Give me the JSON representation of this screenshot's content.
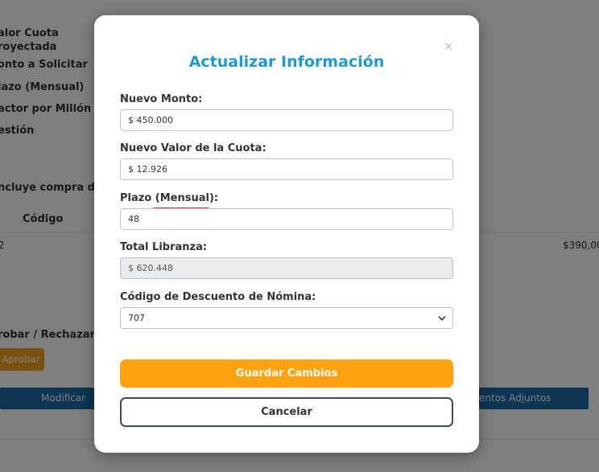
{
  "background": {
    "labels": [
      "alor Cuota",
      "royectada",
      "onto a Solicitar",
      "lazo (Mensual)",
      "actor por Millón",
      "estión",
      "ncluye compra de c",
      "Código",
      "robar / Rechazar So"
    ],
    "row_value_left": "2",
    "row_value_right": "$390,00",
    "approve_label": "Aprobar",
    "modify_label": "Modificar Cre",
    "attachments_label": "entos Adjuntos"
  },
  "modal": {
    "close_label": "×",
    "title": "Actualizar Información",
    "fields": {
      "monto": {
        "label": "Nuevo Monto:",
        "value": "$ 450.000"
      },
      "cuota": {
        "label": "Nuevo Valor de la Cuota:",
        "value": "$ 12.926"
      },
      "plazo": {
        "label": "Plazo (Mensual):",
        "value": "48"
      },
      "total": {
        "label": "Total Libranza:",
        "value": "$ 620.448"
      },
      "codigo": {
        "label": "Código de Descuento de Nómina:",
        "value": "707"
      }
    },
    "save_label": "Guardar Cambios",
    "cancel_label": "Cancelar"
  },
  "colors": {
    "title": "#1a9ad6",
    "save_button": "#ffa20e",
    "accent_underline": "#ea2b5b",
    "overlay": "rgba(0,0,0,0.5)"
  }
}
